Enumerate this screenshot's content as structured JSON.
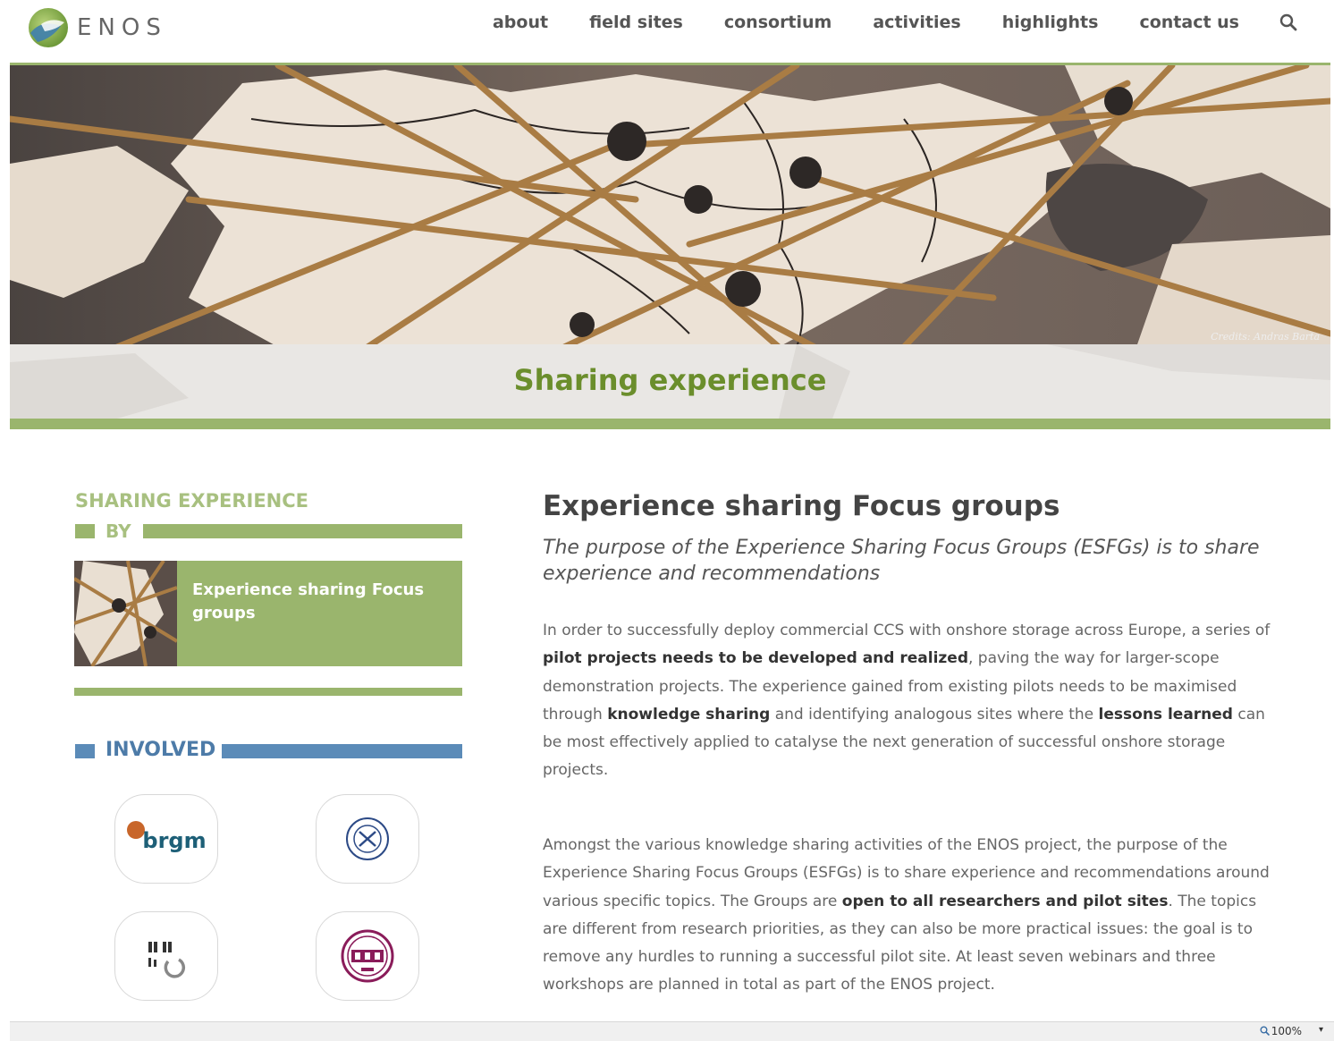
{
  "header": {
    "logo_text": "ENOS",
    "nav": [
      "about",
      "field sites",
      "consortium",
      "activities",
      "highlights",
      "contact us"
    ]
  },
  "hero": {
    "credits": "Credits: Andras Barta",
    "title": "Sharing experience"
  },
  "sidebar": {
    "heading": "SHARING EXPERIENCE",
    "by_label": "BY",
    "card_title": "Experience sharing Focus groups",
    "involved_label": "INVOLVED",
    "partners": [
      {
        "name": "brgm",
        "icon": "brgm-logo"
      },
      {
        "name": "",
        "icon": "university-seal-logo"
      },
      {
        "name": "",
        "icon": "research-institute-logo"
      },
      {
        "name": "",
        "icon": "bgs-seal-logo"
      }
    ]
  },
  "main": {
    "title": "Experience sharing Focus groups",
    "subtitle": "The purpose of the Experience Sharing Focus Groups (ESFGs) is to share experience and recommendations",
    "p1": {
      "t1": "In order to successfully deploy commercial CCS with onshore storage across Europe, a series of ",
      "b1": "pilot projects needs to be developed and realized",
      "t2": ", paving the way for larger-scope demonstration projects. The experience gained from existing pilots needs to be maximised through ",
      "b2": "knowledge sharing",
      "t3": " and identifying analogous sites where the ",
      "b3": "lessons learned",
      "t4": " can be most effectively applied to catalyse the next generation of successful onshore storage projects."
    },
    "p2": {
      "t1": "Amongst the various knowledge sharing activities of the ENOS project, the purpose of the Experience Sharing Focus Groups (ESFGs) is to share experience and recommendations around various specific topics. The Groups are ",
      "b1": "open to all researchers and pilot sites",
      "t2": ". The topics are different from research priorities, as they can also be more practical issues: the goal is to remove any hurdles to running a successful pilot site. At least seven webinars and three workshops are planned in total as part of the ENOS project."
    }
  },
  "statusbar": {
    "zoom": "100%",
    "zoom_arrow": "▾"
  },
  "colors": {
    "accent_green": "#9ab56d",
    "title_green": "#6b8e2c",
    "accent_blue": "#5b8bb8"
  }
}
